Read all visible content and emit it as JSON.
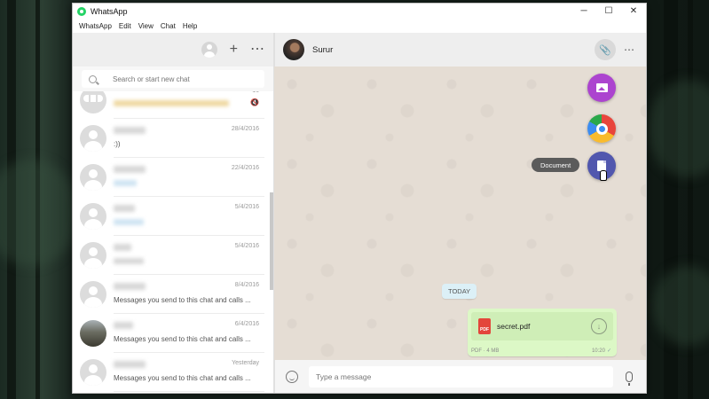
{
  "window": {
    "title": "WhatsApp",
    "controls": {
      "minimize": "─",
      "maximize": "☐",
      "close": "✕"
    }
  },
  "menubar": [
    "WhatsApp",
    "Edit",
    "View",
    "Chat",
    "Help"
  ],
  "left_header": {
    "new_chat": "+",
    "menu": "⋯"
  },
  "search": {
    "placeholder": "Search or start new chat"
  },
  "chats": [
    {
      "date": "16",
      "message": "",
      "muted": true
    },
    {
      "date": "28/4/2016",
      "message": ":))"
    },
    {
      "date": "22/4/2016",
      "message": ""
    },
    {
      "date": "5/4/2016",
      "message": ""
    },
    {
      "date": "5/4/2016",
      "message": ""
    },
    {
      "date": "8/4/2016",
      "message": "Messages you send to this chat and calls ..."
    },
    {
      "date": "6/4/2016",
      "message": "Messages you send to this chat and calls ..."
    },
    {
      "date": "Yesterday",
      "message": "Messages you send to this chat and calls ..."
    }
  ],
  "conversation": {
    "contact_name": "Surur",
    "attach_icon": "📎",
    "menu": "⋯",
    "attach_tooltip": "Document",
    "date_badge": "TODAY",
    "file_message": {
      "file_name": "secret.pdf",
      "file_type_label": "PDF",
      "meta": "PDF · 4 MB",
      "time": "10:20",
      "tick": "✓",
      "download_glyph": "↓"
    },
    "input_placeholder": "Type a message"
  },
  "colors": {
    "fab_photos": "#ac44cf",
    "fab_document": "#5157ae",
    "bubble_outgoing": "#dcf8c6",
    "chat_background": "#e5ddd4",
    "brand_green": "#25d366"
  }
}
